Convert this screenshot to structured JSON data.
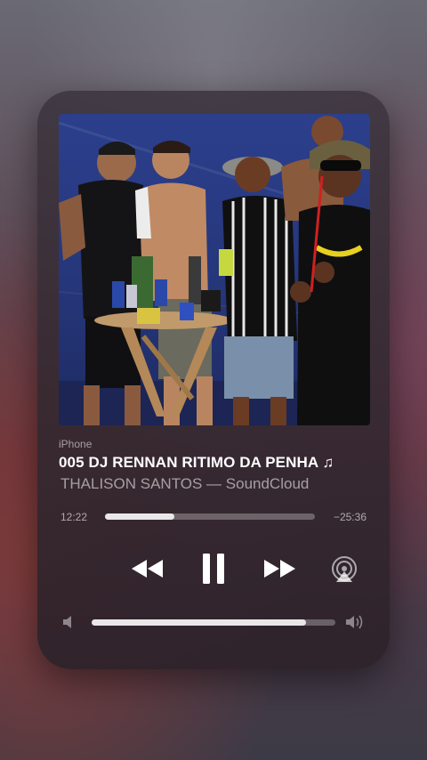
{
  "now_playing": {
    "device": "iPhone",
    "title": "005 DJ RENNAN RITIMO DA PENHA ♫",
    "subtitle": "THALISON SANTOS — SoundCloud",
    "artwork_icon": "album-artwork-photo"
  },
  "progress": {
    "elapsed": "12:22",
    "remaining": "−25:36",
    "fraction": 0.33
  },
  "controls": {
    "previous_icon": "rewind-icon",
    "pause_icon": "pause-icon",
    "next_icon": "fast-forward-icon",
    "airplay_icon": "airplay-icon"
  },
  "volume": {
    "level": 0.88,
    "low_icon": "speaker-low-icon",
    "high_icon": "speaker-high-icon"
  },
  "colors": {
    "primary_text": "#ffffff",
    "secondary_text": "#9a8e96"
  }
}
